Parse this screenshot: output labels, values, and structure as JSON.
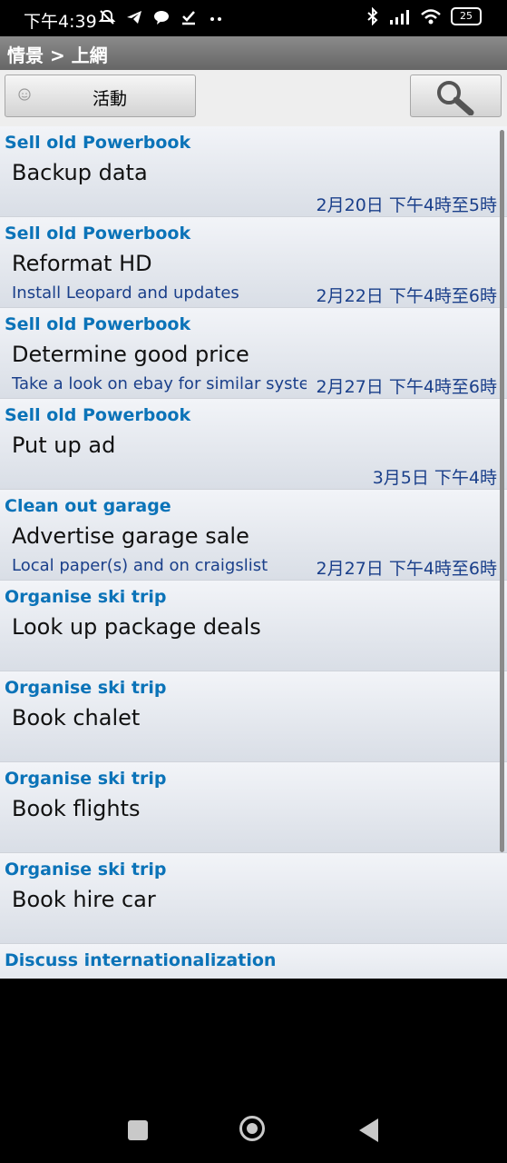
{
  "status_bar": {
    "time": "下午4:39",
    "battery": "25",
    "left_icons": [
      "mute-bell-icon",
      "telegram-icon",
      "chat-icon",
      "download-check-icon",
      "more-dots-icon"
    ],
    "right_icons": [
      "bluetooth-icon",
      "signal-icon",
      "wifi-icon",
      "battery-icon"
    ]
  },
  "title_bar": {
    "breadcrumb": "情景 > 上網"
  },
  "toolbar": {
    "context_button_label": "活動",
    "context_icon": "smiley-icon",
    "search_icon": "magnifier-icon"
  },
  "tasks": [
    {
      "context": "Sell old Powerbook",
      "title": "Backup data",
      "details": "",
      "due": "2月20日 下午4時至5時"
    },
    {
      "context": "Sell old Powerbook",
      "title": "Reformat HD",
      "details": "Install Leopard and updates",
      "due": "2月22日 下午4時至6時"
    },
    {
      "context": "Sell old Powerbook",
      "title": "Determine good price",
      "details": "Take a look on ebay for similar syste...",
      "due": "2月27日 下午4時至6時"
    },
    {
      "context": "Sell old Powerbook",
      "title": "Put up ad",
      "details": "",
      "due": "3月5日 下午4時"
    },
    {
      "context": "Clean out garage",
      "title": "Advertise garage sale",
      "details": "Local paper(s) and on craigslist",
      "due": "2月27日 下午4時至6時"
    },
    {
      "context": "Organise ski trip",
      "title": "Look up package deals",
      "details": "",
      "due": ""
    },
    {
      "context": "Organise ski trip",
      "title": "Book chalet",
      "details": "",
      "due": ""
    },
    {
      "context": "Organise ski trip",
      "title": "Book flights",
      "details": "",
      "due": ""
    },
    {
      "context": "Organise ski trip",
      "title": "Book hire car",
      "details": "",
      "due": ""
    }
  ],
  "partial_task": {
    "context": "Discuss internationalization"
  },
  "colors": {
    "context_text": "#0b73b8",
    "due_text": "#1a3f8a",
    "title_bar": "#777777"
  }
}
